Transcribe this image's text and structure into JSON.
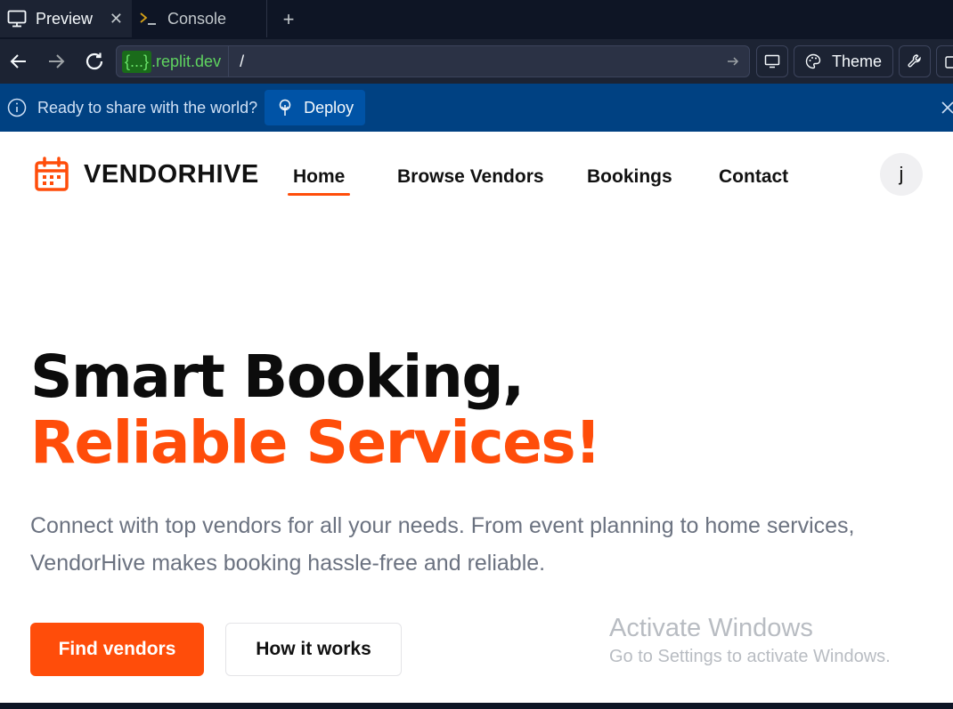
{
  "browser": {
    "tabs": [
      {
        "label": "Preview",
        "icon": "monitor-icon",
        "active": true
      },
      {
        "label": "Console",
        "icon": "terminal-icon",
        "active": false
      }
    ],
    "url": {
      "domain_braces": "{...}",
      "domain": ".replit.dev",
      "path": "/"
    },
    "theme_label": "Theme"
  },
  "banner": {
    "text": "Ready to share with the world?",
    "deploy_label": "Deploy"
  },
  "site": {
    "brand": "VENDORHIVE",
    "nav": [
      "Home",
      "Browse Vendors",
      "Bookings",
      "Contact"
    ],
    "active_nav": "Home",
    "avatar_initial": "j",
    "hero_title_1": "Smart Booking,",
    "hero_title_2": "Reliable Services!",
    "hero_desc_1": "Connect with top vendors for all your needs. From event planning to home services,",
    "hero_desc_2": "VendorHive makes booking hassle-free and reliable.",
    "cta_primary": "Find vendors",
    "cta_secondary": "How it works",
    "accent_color": "#ff4d0a"
  },
  "watermark": {
    "line1": "Activate Windows",
    "line2": "Go to Settings to activate Windows."
  }
}
